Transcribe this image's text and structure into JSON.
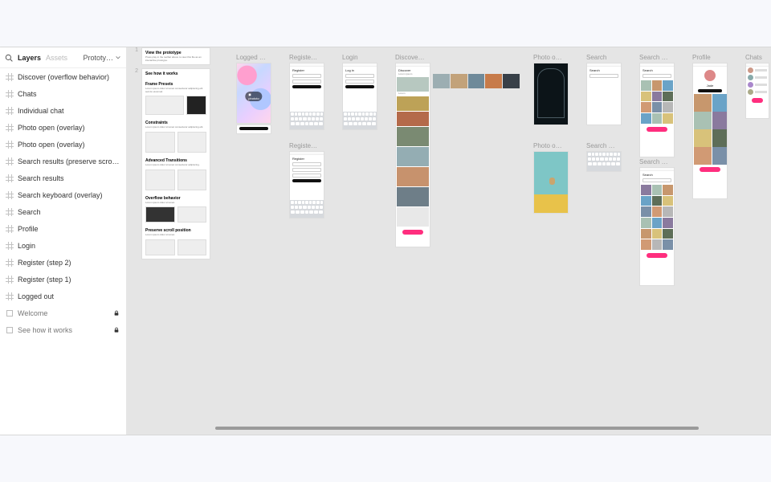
{
  "sidebar": {
    "tabs": {
      "layers": "Layers",
      "assets": "Assets",
      "prototype": "Prototy…"
    },
    "items": [
      {
        "label": "Discover (overflow behavior)",
        "type": "frame"
      },
      {
        "label": "Chats",
        "type": "frame"
      },
      {
        "label": "Individual chat",
        "type": "frame"
      },
      {
        "label": "Photo open (overlay)",
        "type": "frame"
      },
      {
        "label": "Photo open (overlay)",
        "type": "frame"
      },
      {
        "label": "Search results (preserve scroll po…",
        "type": "frame"
      },
      {
        "label": "Search results",
        "type": "frame"
      },
      {
        "label": "Search keyboard (overlay)",
        "type": "frame"
      },
      {
        "label": "Search",
        "type": "frame"
      },
      {
        "label": "Profile",
        "type": "frame"
      },
      {
        "label": "Login",
        "type": "frame"
      },
      {
        "label": "Register (step 2)",
        "type": "frame"
      },
      {
        "label": "Register (step 1)",
        "type": "frame"
      },
      {
        "label": "Logged out",
        "type": "frame"
      },
      {
        "label": "Welcome",
        "type": "page",
        "locked": true
      },
      {
        "label": "See how it works",
        "type": "page",
        "locked": true
      }
    ]
  },
  "welcome": {
    "step1": "1",
    "step2": "2",
    "h1": "View the prototype",
    "p1": "Press play in the toolbar above to view this file as an interactive prototype.",
    "h2": "See how it works",
    "s1t": "Frame Presets",
    "s1b": "",
    "s2t": "Constraints",
    "s2b": "",
    "s3t": "Advanced Transitions",
    "s3b": "",
    "s4t": "Overflow behavior",
    "s4b": "",
    "s5t": "Preserve scroll position",
    "s5b": ""
  },
  "frames": {
    "logged_out": {
      "title": "Logged …",
      "brand": "◼ phototo"
    },
    "register1": {
      "title": "Registe…",
      "h": "Register"
    },
    "register2": {
      "title": "Registe…",
      "h": "Register"
    },
    "login": {
      "title": "Login",
      "h": "Log in"
    },
    "discover": {
      "title": "Discove…",
      "h": "Discover"
    },
    "photo1": {
      "title": "Photo o…"
    },
    "photo2": {
      "title": "Photo o…"
    },
    "search": {
      "title": "Search",
      "h": "Search"
    },
    "search_kbd": {
      "title": "Search …"
    },
    "search_res1": {
      "title": "Search …",
      "h": "Search"
    },
    "search_res2": {
      "title": "Search …",
      "h": "Search"
    },
    "profile": {
      "title": "Profile",
      "name": "Jade"
    },
    "chats": {
      "title": "Chats"
    }
  }
}
